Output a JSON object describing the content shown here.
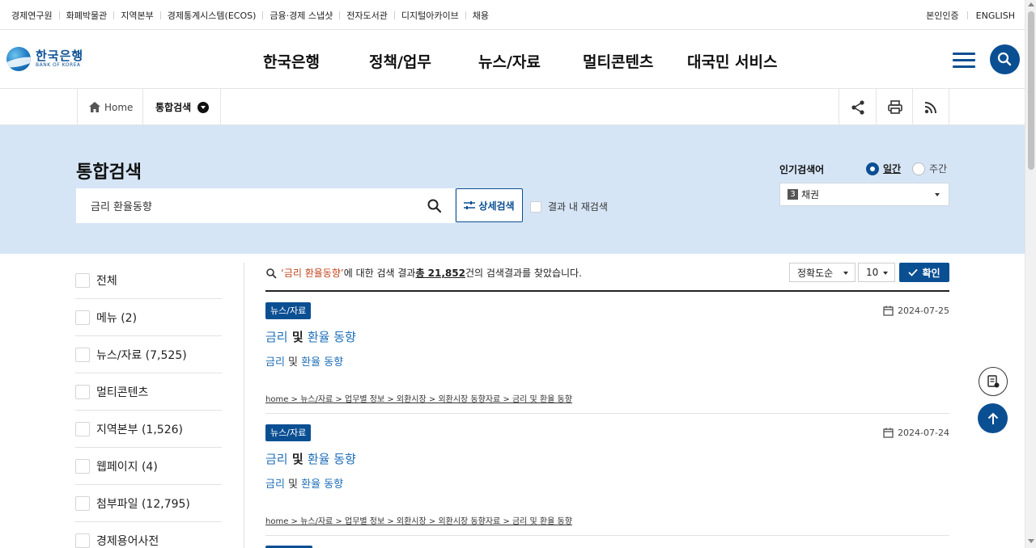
{
  "utility": {
    "left_links": [
      "경제연구원",
      "화폐박물관",
      "지역본부",
      "경제통계시스템(ECOS)",
      "금융·경제 스냅샷",
      "전자도서관",
      "디지털아카이브",
      "채용"
    ],
    "right_links": [
      "본인인증",
      "ENGLISH"
    ]
  },
  "logo": {
    "ko": "한국은행",
    "en": "BANK OF KOREA"
  },
  "gnb": [
    "한국은행",
    "정책/업무",
    "뉴스/자료",
    "멀티콘텐츠",
    "대국민 서비스"
  ],
  "breadcrumb": {
    "home": "Home",
    "current": "통합검색"
  },
  "search": {
    "title": "통합검색",
    "query": "금리 환율동향",
    "advanced_label": "상세검색",
    "research_label": "결과 내 재검색",
    "popular_label": "인기검색어",
    "period_daily": "일간",
    "period_weekly": "주간",
    "popular_rank": "3",
    "popular_term": "채권"
  },
  "filters": [
    "전체",
    "메뉴 (2)",
    "뉴스/자료 (7,525)",
    "멀티콘텐츠",
    "지역본부 (1,526)",
    "웹페이지 (4)",
    "첨부파일 (12,795)",
    "경제용어사전"
  ],
  "results_header": {
    "quote_open": "‘",
    "query": "금리 환율동향",
    "quote_close": "’",
    "mid": "에 대한 검색 결과 ",
    "total": "총 21,852",
    "tail": "건의 검색결과를 찾았습니다.",
    "sort": "정확도순",
    "page_size": "10",
    "confirm": "확인"
  },
  "results": [
    {
      "badge": "뉴스/자료",
      "date": "2024-07-25",
      "title_a": "금리",
      "title_b": " 및 ",
      "title_c": "환율 동향",
      "desc_a": "금리",
      "desc_b": " 및 ",
      "desc_c": "환율 동향",
      "path": "home > 뉴스/자료 > 업무별 정보 > 외환시장 > 외환시장 동향자료 > 금리 및 환율 동향"
    },
    {
      "badge": "뉴스/자료",
      "date": "2024-07-24",
      "title_a": "금리",
      "title_b": " 및 ",
      "title_c": "환율 동향",
      "desc_a": "금리",
      "desc_b": " 및 ",
      "desc_c": "환율 동향",
      "path": "home > 뉴스/자료 > 업무별 정보 > 외환시장 > 외환시장 동향자료 > 금리 및 환율 동향"
    }
  ],
  "colors": {
    "brand": "#0b4f93",
    "band": "#d6e5f6",
    "highlight": "#c2461f",
    "link": "#1f6fb8"
  }
}
